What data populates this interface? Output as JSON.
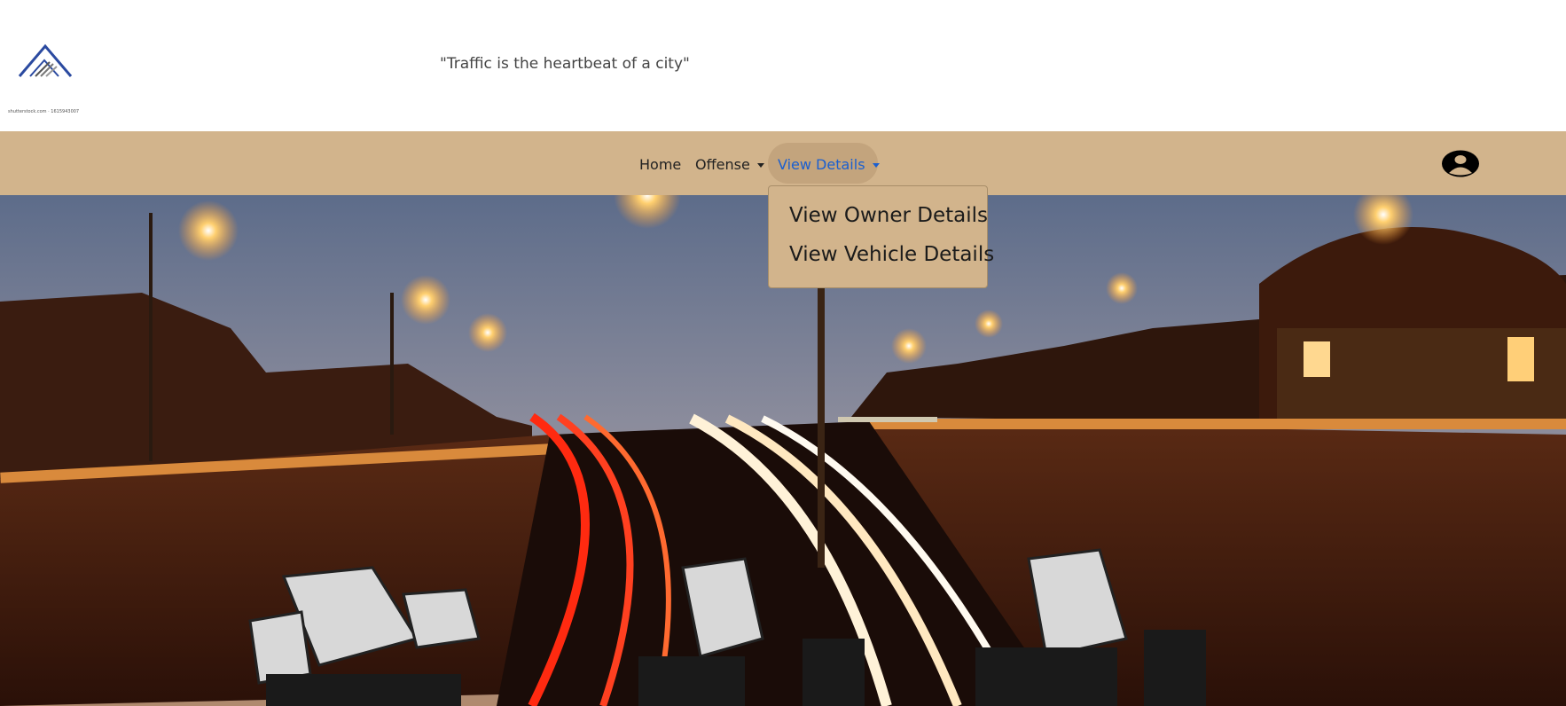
{
  "header": {
    "logo_icon": "mountain-logo-icon",
    "logo_caption": "shutterstock.com · 1615943007",
    "tagline": "\"Traffic is the heartbeat of a city\""
  },
  "navbar": {
    "background": "#d2b48c",
    "items": [
      {
        "label": "Home"
      },
      {
        "label": "Offense",
        "has_dropdown": true
      },
      {
        "label": "View Details",
        "has_dropdown": true,
        "active": true
      }
    ],
    "active_color": "#1a5fd0",
    "profile_icon": "user-circle-icon"
  },
  "dropdown": {
    "items": [
      {
        "label": "View Owner Details"
      },
      {
        "label": "View Vehicle Details"
      }
    ]
  },
  "hero": {
    "image": "night-highway-with-traffic-cameras"
  }
}
